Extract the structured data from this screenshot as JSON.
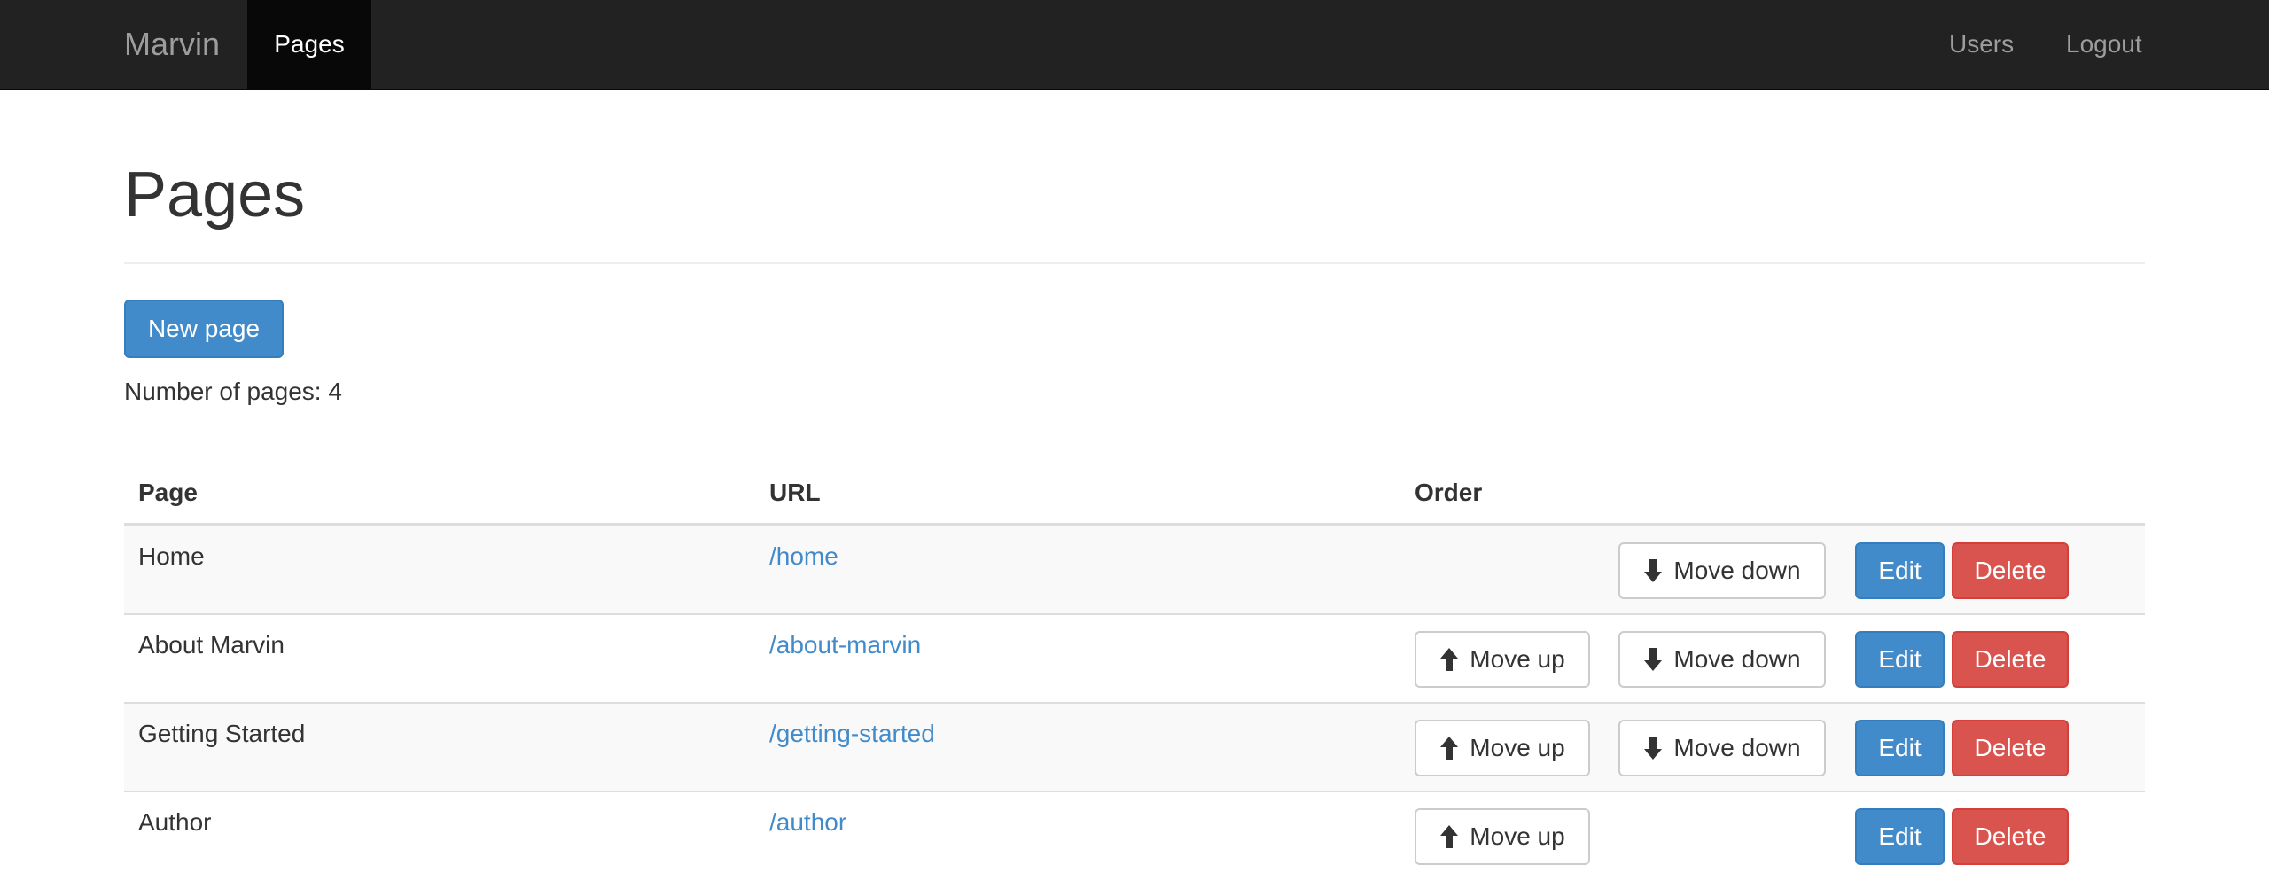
{
  "navbar": {
    "brand": "Marvin",
    "active_item": "Pages",
    "right_items": [
      "Users",
      "Logout"
    ]
  },
  "main": {
    "title": "Pages",
    "new_button": "New page",
    "count_label": "Number of pages:",
    "count_value": "4"
  },
  "table": {
    "headers": {
      "page": "Page",
      "url": "URL",
      "order": "Order"
    },
    "actions": {
      "move_up": "Move up",
      "move_down": "Move down",
      "edit": "Edit",
      "delete": "Delete"
    },
    "rows": [
      {
        "page": "Home",
        "url": "/home"
      },
      {
        "page": "About Marvin",
        "url": "/about-marvin"
      },
      {
        "page": "Getting Started",
        "url": "/getting-started"
      },
      {
        "page": "Author",
        "url": "/author"
      }
    ]
  },
  "colors": {
    "navbar_bg": "#222222",
    "primary": "#428bca",
    "danger": "#d9534f",
    "link": "#428bca"
  },
  "icons": {
    "move_up": "arrow-up-icon",
    "move_down": "arrow-down-icon"
  }
}
